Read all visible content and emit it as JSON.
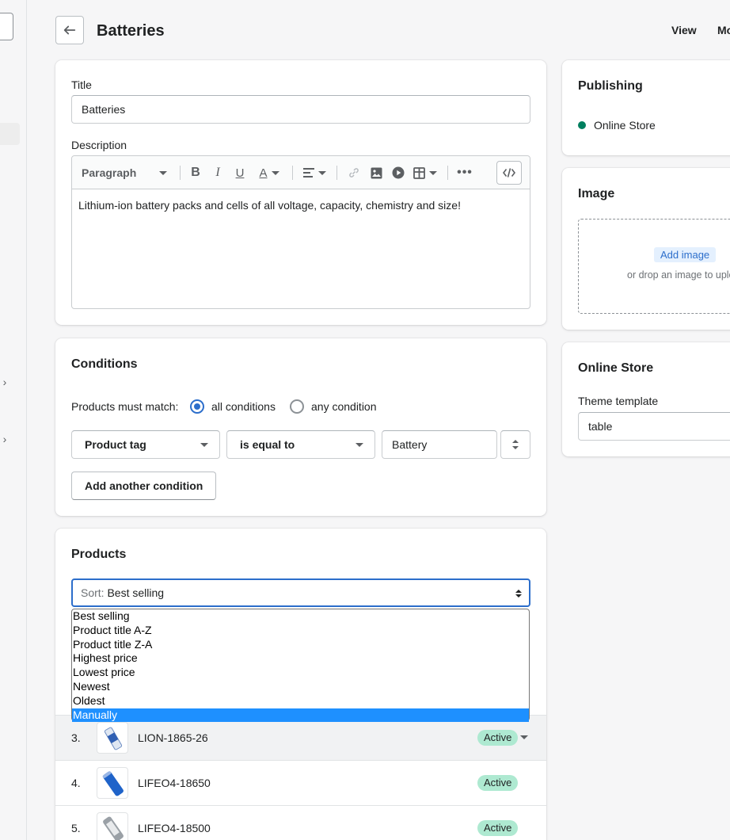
{
  "header": {
    "title": "Batteries",
    "actions": [
      "View",
      "Mo"
    ]
  },
  "details": {
    "title_label": "Title",
    "title_value": "Batteries",
    "description_label": "Description",
    "toolbar_paragraph": "Paragraph",
    "description_text": "Lithium-ion battery packs and cells of all voltage, capacity, chemistry and size!"
  },
  "conditions": {
    "title": "Conditions",
    "match_label": "Products must match:",
    "option_all": "all conditions",
    "option_any": "any condition",
    "field": "Product tag",
    "operator": "is equal to",
    "value": "Battery",
    "add_button": "Add another condition"
  },
  "products": {
    "title": "Products",
    "sort_prefix": "Sort:",
    "sort_value": "Best selling",
    "sort_options": [
      "Best selling",
      "Product title A-Z",
      "Product title Z-A",
      "Highest price",
      "Lowest price",
      "Newest",
      "Oldest",
      "Manually"
    ],
    "rows": [
      {
        "num": "3.",
        "name": "LION-1865-26",
        "status": "Active"
      },
      {
        "num": "4.",
        "name": "LIFEO4-18650",
        "status": "Active"
      },
      {
        "num": "5.",
        "name": "LIFEO4-18500",
        "status": "Active"
      }
    ]
  },
  "publishing": {
    "title": "Publishing",
    "channel": "Online Store"
  },
  "image": {
    "title": "Image",
    "add_button": "Add image",
    "hint": "or drop an image to uplo"
  },
  "online_store": {
    "title": "Online Store",
    "template_label": "Theme template",
    "template_value": "table"
  },
  "colors": {
    "accent": "#2c6ecb",
    "active_badge": "#aee9d1",
    "published_dot": "#007f5f"
  }
}
